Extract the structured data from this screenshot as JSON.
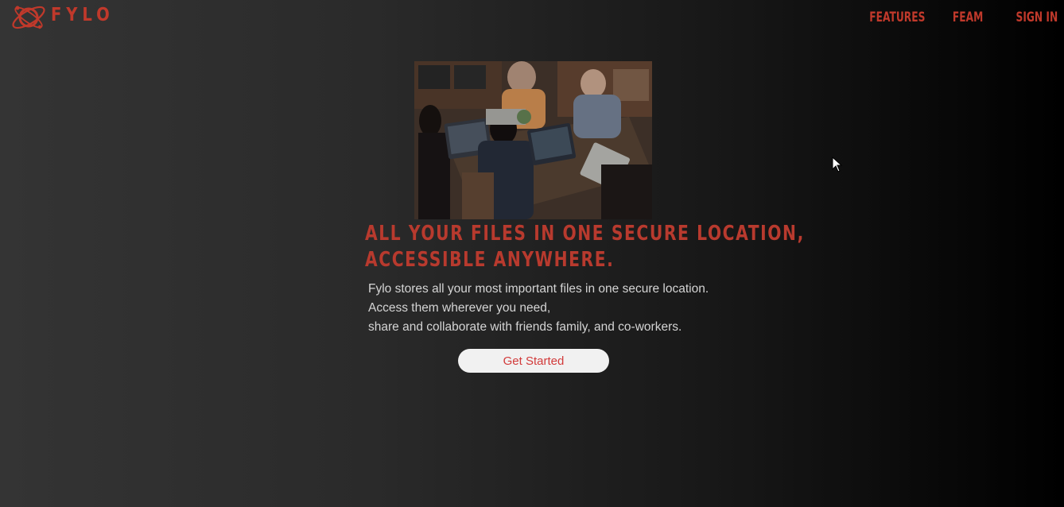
{
  "brand": {
    "name": "FYLO",
    "icon": "orbit-logo-icon",
    "color": "#c0392b"
  },
  "nav": {
    "items": [
      {
        "label": "FEATURES"
      },
      {
        "label": "FEAM"
      },
      {
        "label": "SIGN IN"
      }
    ]
  },
  "hero": {
    "image": "team-working-on-laptops-photo",
    "headline_line1": "ALL YOUR FILES IN ONE SECURE LOCATION,",
    "headline_line2": "ACCESSIBLE ANYWHERE.",
    "description": [
      "Fylo stores all your most important files in one secure location.",
      "Access them wherever you need,",
      "share and collaborate with friends family, and co-workers."
    ],
    "cta_label": "Get Started"
  },
  "colors": {
    "accent": "#c0392b",
    "button_bg": "#f1f1f1",
    "button_text": "#d23a3a",
    "text": "#d4d4d4"
  }
}
